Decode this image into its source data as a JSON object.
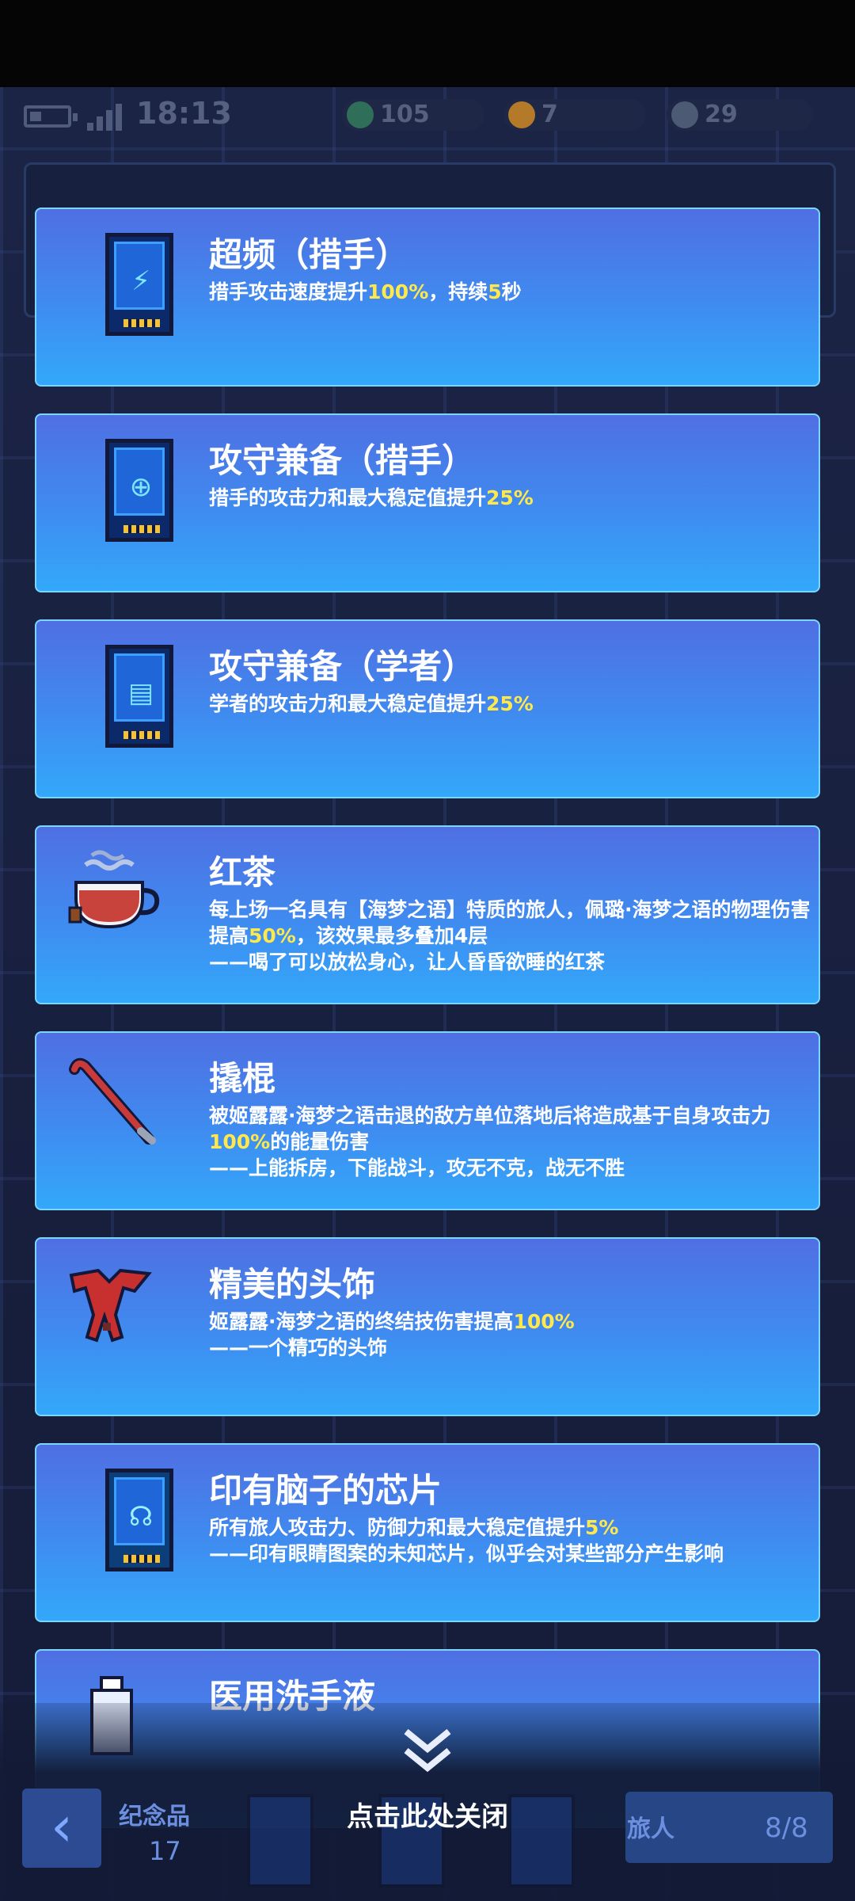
{
  "status": {
    "time": "18:13"
  },
  "currencies": [
    {
      "value": "105",
      "color": "#2f6f5a"
    },
    {
      "value": "7",
      "color": "#b5792a"
    },
    {
      "value": "29",
      "color": "#4d5a74"
    }
  ],
  "cards": [
    {
      "title": "超频（措手）",
      "desc": [
        {
          "t": "措手攻击速度提升"
        },
        {
          "t": "100%",
          "hl": true
        },
        {
          "t": "，持续"
        },
        {
          "t": "5",
          "hl": true
        },
        {
          "t": "秒"
        }
      ],
      "flavor": ""
    },
    {
      "title": "攻守兼备（措手）",
      "desc": [
        {
          "t": "措手的攻击力和最大稳定值提升"
        },
        {
          "t": "25%",
          "hl": true
        }
      ],
      "flavor": ""
    },
    {
      "title": "攻守兼备（学者）",
      "desc": [
        {
          "t": "学者的攻击力和最大稳定值提升"
        },
        {
          "t": "25%",
          "hl": true
        }
      ],
      "flavor": ""
    },
    {
      "title": "红茶",
      "desc": [
        {
          "t": "每上场一名具有【海梦之语】特质的旅人，佩璐·海梦之语的物理伤害提高"
        },
        {
          "t": "50%",
          "hl": true
        },
        {
          "t": "，该效果最多叠加4层"
        }
      ],
      "flavor": "——喝了可以放松身心，让人昏昏欲睡的红茶"
    },
    {
      "title": "撬棍",
      "desc": [
        {
          "t": "被姬露露·海梦之语击退的敌方单位落地后将造成基于自身攻击力"
        },
        {
          "t": "100%",
          "hl": true
        },
        {
          "t": "的能量伤害"
        }
      ],
      "flavor": "——上能拆房，下能战斗，攻无不克，战无不胜"
    },
    {
      "title": "精美的头饰",
      "desc": [
        {
          "t": "姬露露·海梦之语的终结技伤害提高"
        },
        {
          "t": "100%",
          "hl": true
        }
      ],
      "flavor": "——一个精巧的头饰"
    },
    {
      "title": "印有脑子的芯片",
      "desc": [
        {
          "t": "所有旅人攻击力、防御力和最大稳定值提升"
        },
        {
          "t": "5%",
          "hl": true
        }
      ],
      "flavor": "——印有眼睛图案的未知芯片，似乎会对某些部分产生影响"
    },
    {
      "title": "医用洗手液",
      "desc": [],
      "flavor": ""
    }
  ],
  "footer": {
    "close_hint": "点击此处关闭",
    "souvenir_label": "纪念品",
    "souvenir_count": "17",
    "traveler_label": "旅人",
    "traveler_count": "8/8"
  }
}
